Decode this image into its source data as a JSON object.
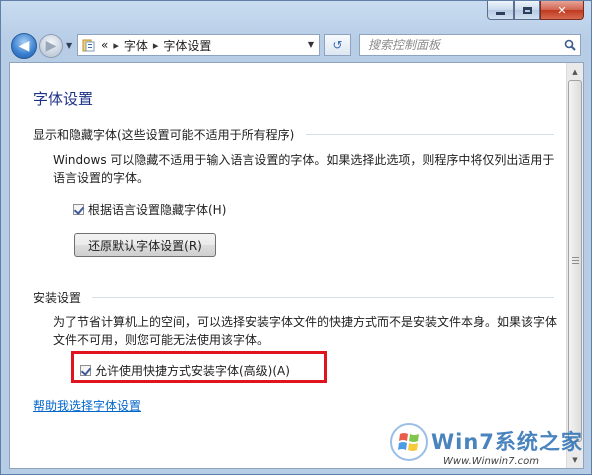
{
  "window": {
    "caption_min": "",
    "caption_max": "",
    "caption_close": "✕"
  },
  "nav": {
    "breadcrumb_lead": "«",
    "breadcrumb": [
      "字体",
      "字体设置"
    ],
    "search_placeholder": "搜索控制面板"
  },
  "page": {
    "title": "字体设置",
    "sections": [
      {
        "heading": "显示和隐藏字体(这些设置可能不适用于所有程序)",
        "description": "Windows 可以隐藏不适用于输入语言设置的字体。如果选择此选项，则程序中将仅列出适用于语言设置的字体。",
        "checkbox_label": "根据语言设置隐藏字体(H)",
        "checkbox_checked": true,
        "button_label": "还原默认字体设置(R)"
      },
      {
        "heading": "安装设置",
        "description": "为了节省计算机上的空间，可以选择安装字体文件的快捷方式而不是安装文件本身。如果该字体文件不可用，则您可能无法使用该字体。",
        "checkbox_label": "允许使用快捷方式安装字体(高级)(A)",
        "checkbox_checked": true
      }
    ],
    "help_link": "帮助我选择字体设置"
  },
  "watermark": {
    "brand": "Win7系统之家",
    "url": "Www.Winwin7.com"
  },
  "colors": {
    "title": "#1e3287",
    "link": "#0066cc",
    "highlight": "#e0141d"
  }
}
